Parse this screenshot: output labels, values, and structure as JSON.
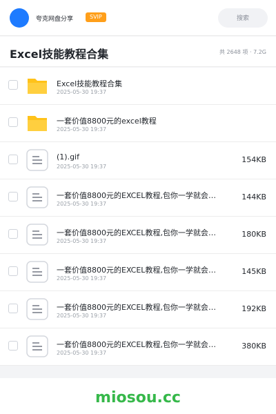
{
  "header": {
    "share_name": "夸克网盘分享",
    "badge": "SVIP",
    "search_placeholder": "搜索",
    "accent_color": "#1e7bff",
    "badge_color": "#ff9f1a"
  },
  "folder": {
    "title": "Excel技能教程合集",
    "summary": "共 2648 项 · 7.2G"
  },
  "files": [
    {
      "name": "Excel技能教程合集",
      "date": "2025-05-30 19:37",
      "size": "",
      "icon": "folder-icon"
    },
    {
      "name": "一套价值8800元的excel教程",
      "date": "2025-05-30 19:37",
      "size": "",
      "icon": "folder-icon"
    },
    {
      "name": "(1).gif",
      "date": "2025-05-30 19:37",
      "size": "154KB",
      "icon": "document-icon"
    },
    {
      "name": "一套价值8800元的EXCEL教程,包你一学就会，…",
      "date": "2025-05-30 19:37",
      "size": "144KB",
      "icon": "document-icon"
    },
    {
      "name": "一套价值8800元的EXCEL教程,包你一学就会，…",
      "date": "2025-05-30 19:37",
      "size": "180KB",
      "icon": "document-icon"
    },
    {
      "name": "一套价值8800元的EXCEL教程,包你一学就会，…",
      "date": "2025-05-30 19:37",
      "size": "145KB",
      "icon": "document-icon"
    },
    {
      "name": "一套价值8800元的EXCEL教程,包你一学就会，…",
      "date": "2025-05-30 19:37",
      "size": "192KB",
      "icon": "document-icon"
    },
    {
      "name": "一套价值8800元的EXCEL教程,包你一学就会，…",
      "date": "2025-05-30 19:37",
      "size": "380KB",
      "icon": "document-icon"
    }
  ],
  "footer": {
    "brand": "miosou.cc",
    "brand_color": "#36b84a"
  }
}
